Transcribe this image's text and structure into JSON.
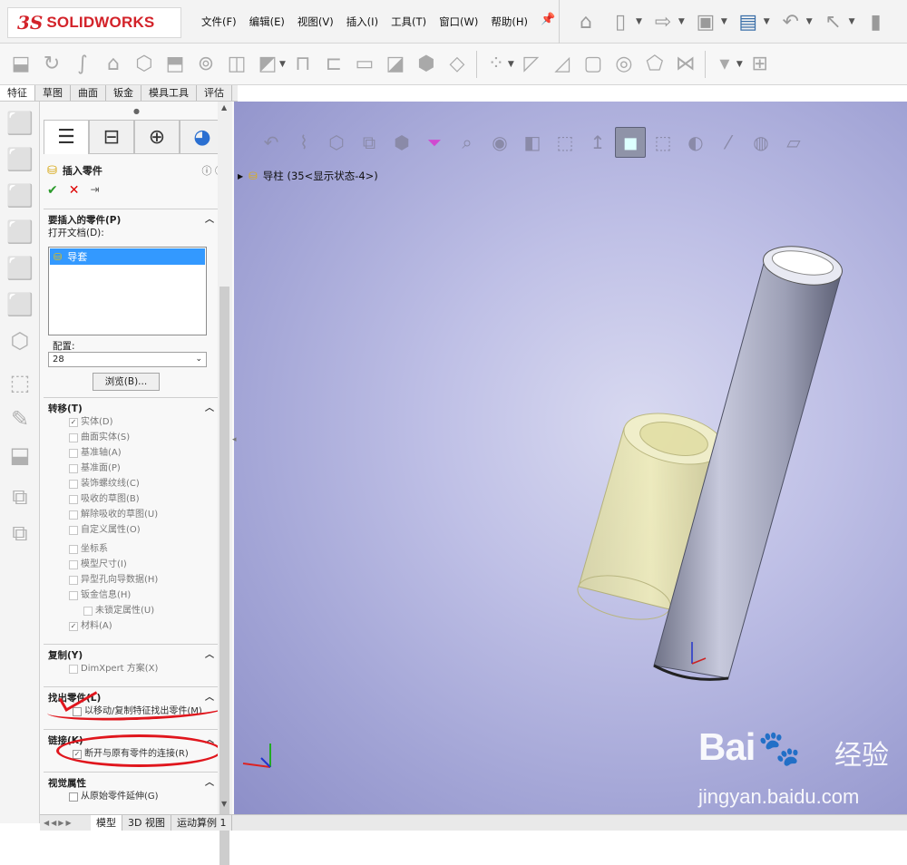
{
  "app": {
    "logo_prefix": "3S",
    "logo_name": "SOLIDWORKS"
  },
  "menu": [
    "文件(F)",
    "编辑(E)",
    "视图(V)",
    "插入(I)",
    "工具(T)",
    "窗口(W)",
    "帮助(H)"
  ],
  "command_tabs": [
    "特征",
    "草图",
    "曲面",
    "钣金",
    "模具工具",
    "评估"
  ],
  "active_command_tab": "特征",
  "property_manager": {
    "title": "插入零件",
    "help_icons": [
      "?",
      "?"
    ],
    "sections": {
      "parts_to_insert": {
        "title": "要插入的零件(P)",
        "open_docs_label": "打开文档(D):",
        "open_docs": [
          "导套"
        ],
        "config_label": "配置:",
        "config_value": "28",
        "browse_label": "浏览(B)..."
      },
      "transfer": {
        "title": "转移(T)",
        "items": [
          {
            "label": "实体(D)",
            "checked": true,
            "indent": 0
          },
          {
            "label": "曲面实体(S)",
            "checked": false,
            "indent": 0
          },
          {
            "label": "基准轴(A)",
            "checked": false,
            "indent": 0
          },
          {
            "label": "基准面(P)",
            "checked": false,
            "indent": 0
          },
          {
            "label": "装饰螺纹线(C)",
            "checked": false,
            "indent": 0
          },
          {
            "label": "吸收的草图(B)",
            "checked": false,
            "indent": 0
          },
          {
            "label": "解除吸收的草图(U)",
            "checked": false,
            "indent": 0
          },
          {
            "label": "自定义属性(O)",
            "checked": false,
            "indent": 0
          },
          {
            "label": "坐标系",
            "checked": false,
            "indent": 0
          },
          {
            "label": "模型尺寸(I)",
            "checked": false,
            "indent": 0
          },
          {
            "label": "异型孔向导数据(H)",
            "checked": false,
            "indent": 0
          },
          {
            "label": "钣金信息(H)",
            "checked": false,
            "indent": 0
          },
          {
            "label": "未锁定属性(U)",
            "checked": false,
            "indent": 1
          },
          {
            "label": "材料(A)",
            "checked": true,
            "indent": 0
          }
        ]
      },
      "copy": {
        "title": "复制(Y)",
        "items": [
          {
            "label": "DimXpert 方案(X)",
            "checked": false
          }
        ]
      },
      "locate": {
        "title": "找出零件(L)",
        "items": [
          {
            "label": "以移动/复制特征找出零件(M)",
            "checked": false
          }
        ]
      },
      "link": {
        "title": "链接(K)",
        "items": [
          {
            "label": "断开与原有零件的连接(R)",
            "checked": true
          }
        ]
      },
      "visual": {
        "title": "视觉属性",
        "items": [
          {
            "label": "从原始零件延伸(G)",
            "checked": false
          }
        ]
      }
    }
  },
  "viewport": {
    "tree_root": "导柱 (35<显示状态-4>)"
  },
  "bottom_tabs": [
    "模型",
    "3D 视图",
    "运动算例 1"
  ],
  "active_bottom_tab": "模型",
  "watermark": {
    "logo": "Bai",
    "logo_tail": "经验",
    "url": "jingyan.baidu.com"
  },
  "colors": {
    "accent_red": "#d3232a",
    "selection_blue": "#3399ff",
    "annotation_red": "#e0161d"
  }
}
